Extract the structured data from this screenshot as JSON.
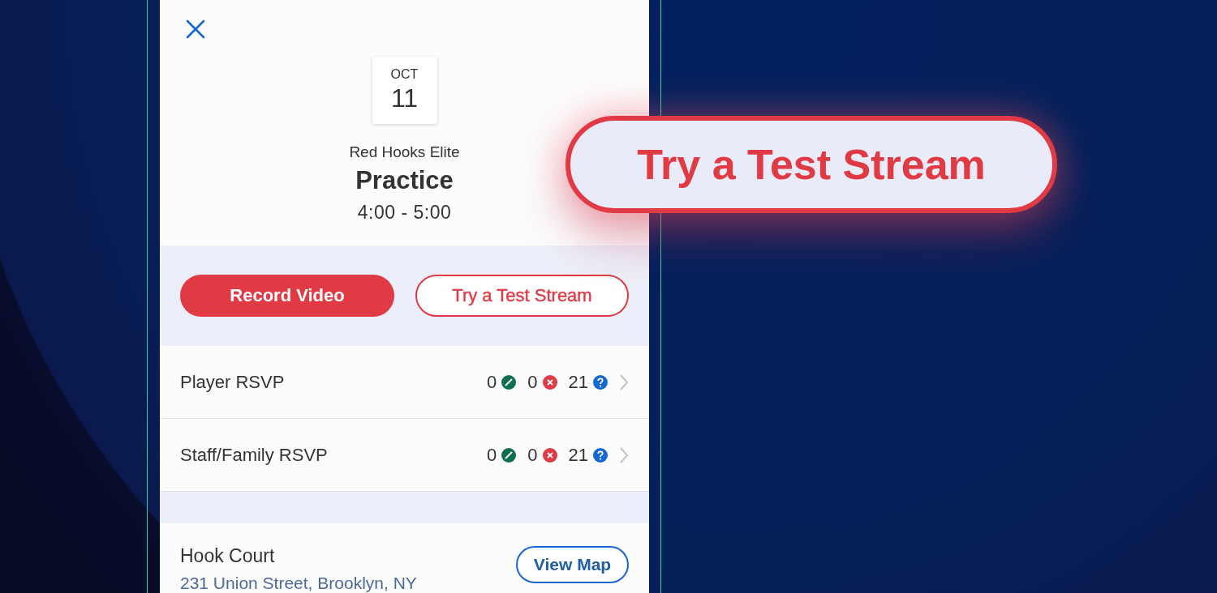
{
  "event": {
    "month": "OCT",
    "day": "11",
    "team": "Red Hooks Elite",
    "title": "Practice",
    "time": "4:00 - 5:00"
  },
  "actions": [
    {
      "label": "Record Video",
      "kind": "primary"
    },
    {
      "label": "Try a Test Stream",
      "kind": "outline"
    }
  ],
  "rsvp_rows": [
    {
      "label": "Player RSVP",
      "counts": [
        {
          "kind": "yes",
          "value": "0"
        },
        {
          "kind": "no",
          "value": "0"
        },
        {
          "kind": "unknown",
          "value": "21"
        }
      ]
    },
    {
      "label": "Staff/Family RSVP",
      "counts": [
        {
          "kind": "yes",
          "value": "0"
        },
        {
          "kind": "no",
          "value": "0"
        },
        {
          "kind": "unknown",
          "value": "21"
        }
      ]
    }
  ],
  "location": {
    "name": "Hook Court",
    "address": "231 Union Street, Brooklyn, NY",
    "button": "View Map"
  },
  "callout": {
    "label": "Try a Test Stream"
  }
}
